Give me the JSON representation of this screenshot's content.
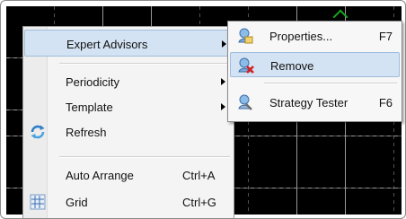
{
  "context_menu": {
    "items": [
      {
        "label": "Expert Advisors",
        "shortcut": "",
        "submenu": true,
        "icon": "none"
      },
      {
        "label": "Periodicity",
        "shortcut": "",
        "submenu": true,
        "icon": "none"
      },
      {
        "label": "Template",
        "shortcut": "",
        "submenu": true,
        "icon": "none"
      },
      {
        "label": "Refresh",
        "shortcut": "",
        "submenu": false,
        "icon": "refresh-icon"
      },
      {
        "label": "Auto Arrange",
        "shortcut": "Ctrl+A",
        "submenu": false,
        "icon": "none"
      },
      {
        "label": "Grid",
        "shortcut": "Ctrl+G",
        "submenu": false,
        "icon": "grid-icon"
      }
    ]
  },
  "submenu": {
    "items": [
      {
        "label": "Properties...",
        "shortcut": "F7",
        "icon": "expert-properties-icon"
      },
      {
        "label": "Remove",
        "shortcut": "",
        "icon": "expert-remove-icon"
      },
      {
        "label": "Strategy Tester",
        "shortcut": "F6",
        "icon": "strategy-tester-icon"
      }
    ]
  },
  "colors": {
    "chart_background": "#000000",
    "grid": "#9a9a9a",
    "menu_background": "#f4f4f4",
    "highlight": "#d4e3f3",
    "highlight_border": "#9fbcdc"
  }
}
